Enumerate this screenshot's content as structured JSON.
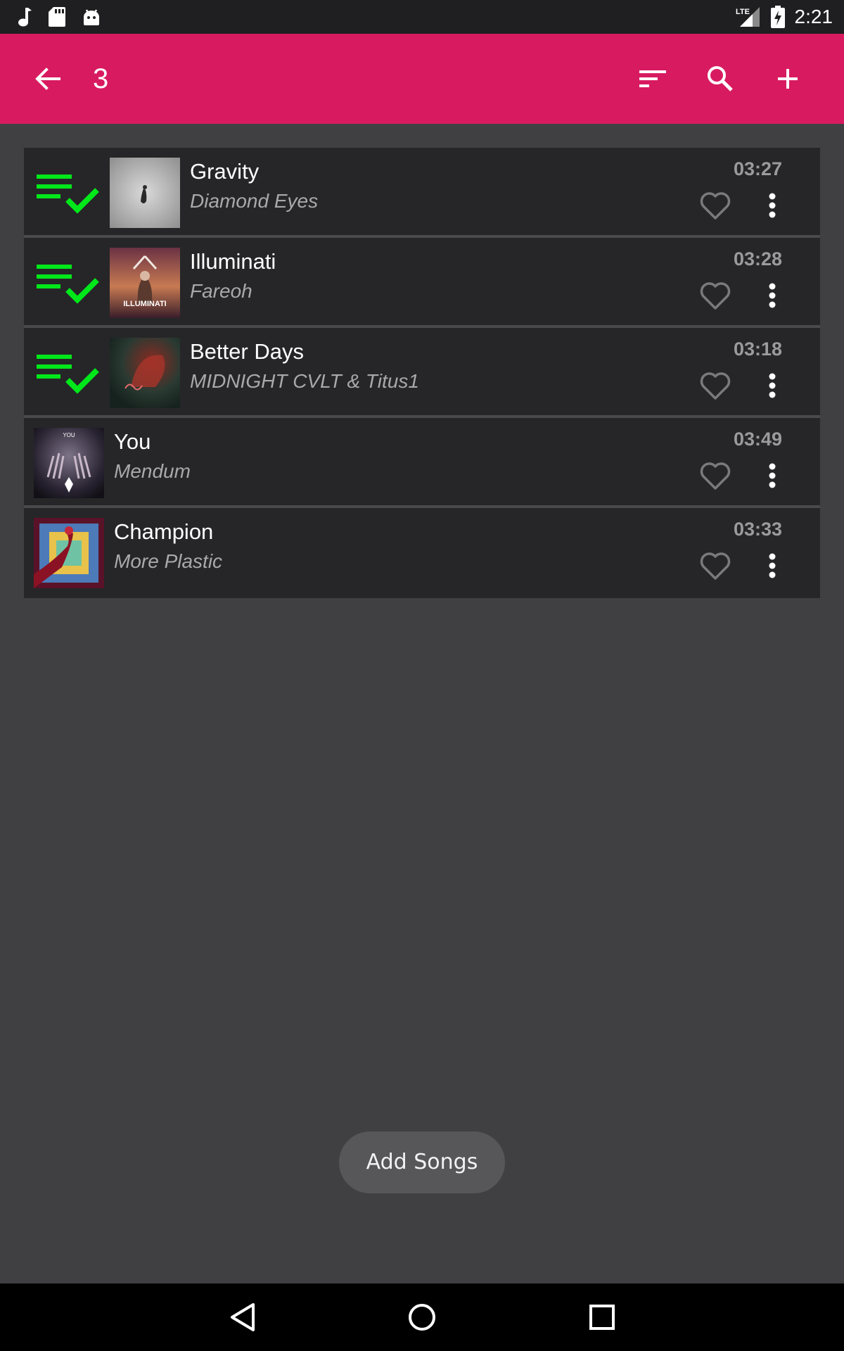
{
  "status_bar": {
    "network_label": "LTE",
    "time": "2:21"
  },
  "app_bar": {
    "title": "3",
    "background": "#d81b60"
  },
  "songs": [
    {
      "title": "Gravity",
      "artist": "Diamond Eyes",
      "duration": "03:27",
      "queued": true
    },
    {
      "title": "Illuminati",
      "artist": "Fareoh",
      "duration": "03:28",
      "queued": true
    },
    {
      "title": "Better Days",
      "artist": "MIDNIGHT CVLT & Titus1",
      "duration": "03:18",
      "queued": true
    },
    {
      "title": "You",
      "artist": "Mendum",
      "duration": "03:49",
      "queued": false
    },
    {
      "title": "Champion",
      "artist": "More Plastic",
      "duration": "03:33",
      "queued": false
    }
  ],
  "add_songs_label": "Add Songs",
  "colors": {
    "accent": "#d81b60",
    "queue_icon": "#00e81a",
    "row_background": "#262628",
    "page_background": "#404042"
  },
  "art_overlays": {
    "illuminati": "ILLUMINATI",
    "you": "YOU"
  }
}
